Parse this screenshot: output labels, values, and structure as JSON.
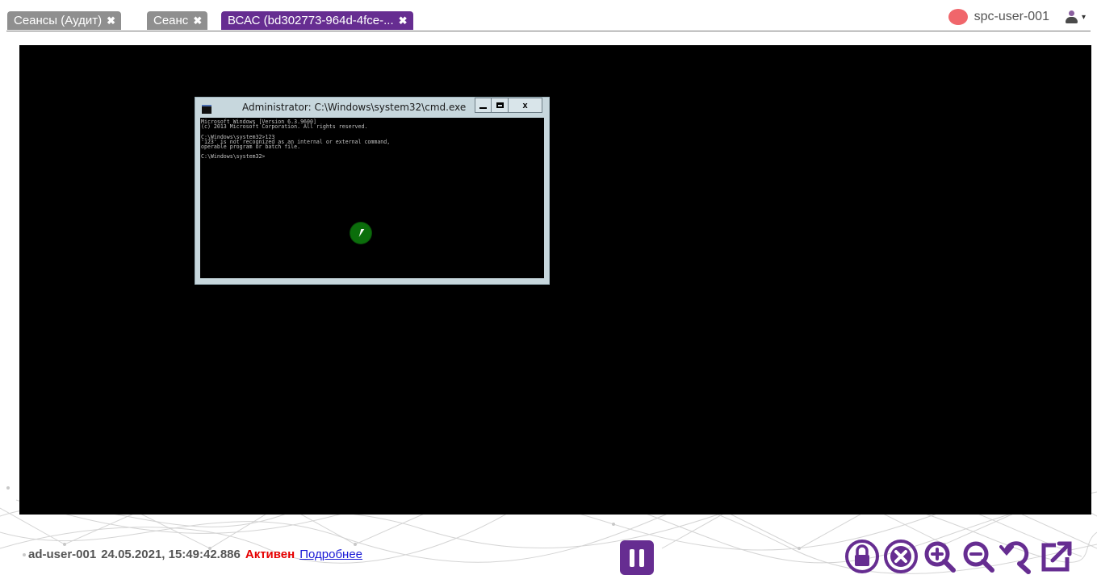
{
  "tabs": [
    {
      "label": "Сеансы (Аудит)",
      "active": false,
      "close_icon": "close-icon"
    },
    {
      "label": "Сеанс",
      "active": false,
      "close_icon": "close-icon"
    },
    {
      "label": "ВСАС (bd302773-964d-4fce-...",
      "active": true,
      "close_icon": "close-icon"
    }
  ],
  "tab_close_glyph": "✖",
  "user": {
    "name": "spc-user-001",
    "status_color": "#f0666b",
    "menu_icon": "user-menu-icon",
    "caret": "▾"
  },
  "cmd_window": {
    "title": "Administrator: C:\\Windows\\system32\\cmd.exe",
    "min_label": "",
    "close_label": "x",
    "console_lines": [
      "Microsoft Windows [Version 6.3.9600]",
      "(c) 2013 Microsoft Corporation. All rights reserved.",
      "",
      "C:\\Windows\\system32>123",
      "'123' is not recognized as an internal or external command,",
      "operable program or batch file.",
      "",
      "C:\\Windows\\system32>"
    ]
  },
  "status": {
    "user": "ad-user-001",
    "datetime": "24.05.2021, 15:49:42.886",
    "state": "Активен",
    "state_color": "#e60000",
    "details_link": "Подробнее"
  },
  "controls": {
    "accent": "#662d91",
    "pause_icon": "pause-icon",
    "tools": [
      "lock-icon",
      "close-circle-icon",
      "zoom-in-icon",
      "zoom-out-icon",
      "zoom-reset-icon",
      "external-link-icon"
    ]
  }
}
